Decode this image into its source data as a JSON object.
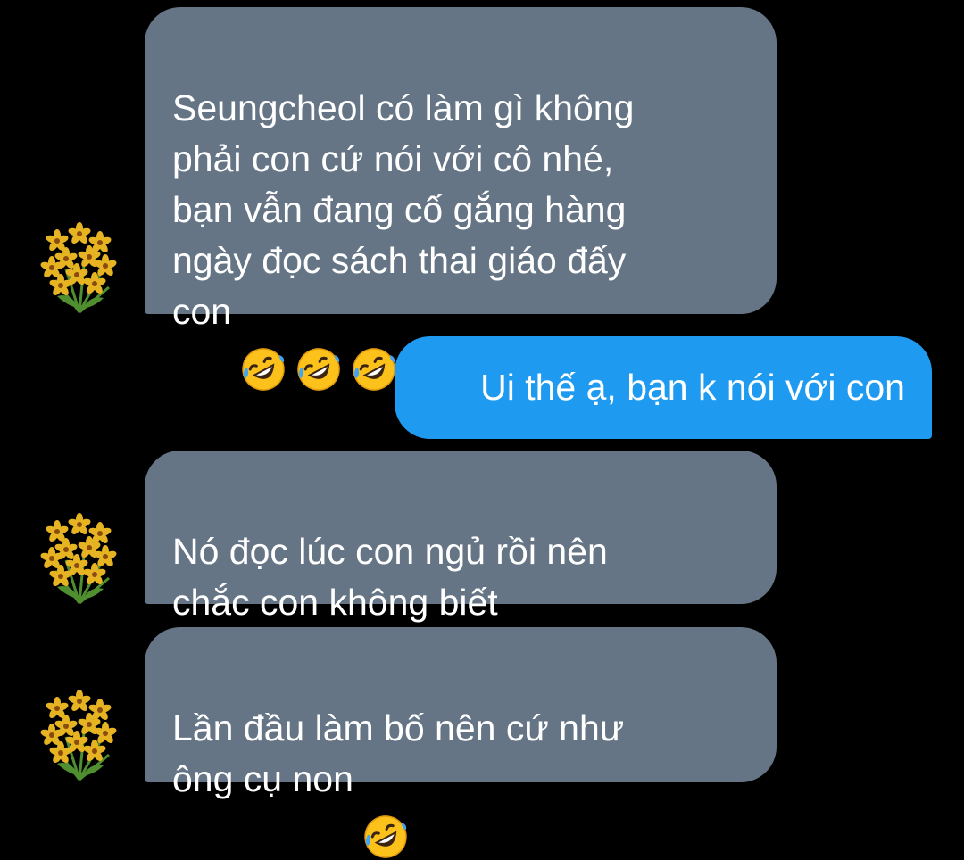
{
  "colors": {
    "incoming_bubble": "#657585",
    "outgoing_bubble": "#1e9bf0",
    "background": "#000000",
    "avatar_flower": "#e6b422",
    "avatar_leaf": "#4f8f2f"
  },
  "contact": {
    "avatar_icon": "yellow-flower-bouquet-icon"
  },
  "messages": [
    {
      "sender": "contact",
      "text": "Seungcheol có làm gì không\nphải con cứ nói với cô nhé,\nbạn vẫn đang cố gắng hàng\nngày đọc sách thai giáo đấy\ncon",
      "emoji": "rolling-on-floor-laughing-icon",
      "emoji_count": 3
    },
    {
      "sender": "me",
      "text": "Ui thế ạ, bạn k nói với con"
    },
    {
      "sender": "contact",
      "text": "Nó đọc lúc con ngủ rồi nên\nchắc con không biết"
    },
    {
      "sender": "contact",
      "text": "Lần đầu làm bố nên cứ như\nông cụ non",
      "emoji": "rolling-on-floor-laughing-icon",
      "emoji_count": 1
    }
  ]
}
